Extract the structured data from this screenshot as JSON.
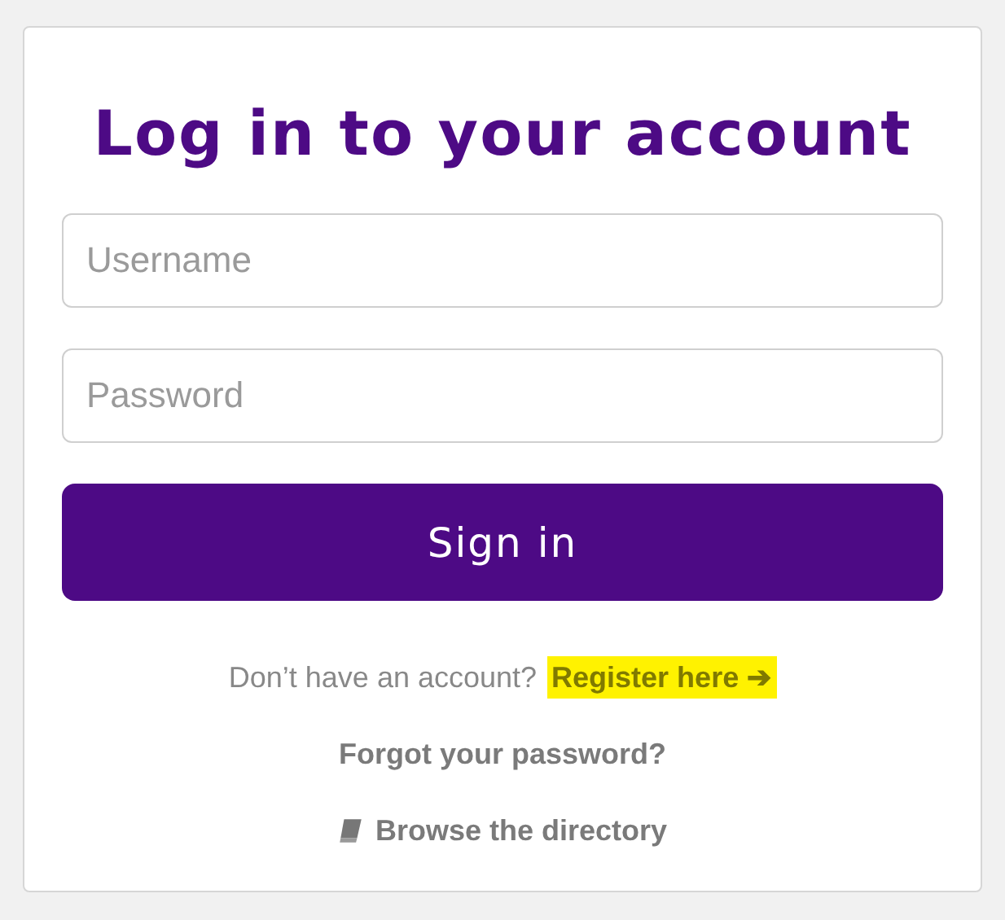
{
  "title": "Log in to your account",
  "fields": [
    {
      "placeholder": "Username"
    },
    {
      "placeholder": "Password"
    }
  ],
  "submit": "Sign in",
  "register": {
    "prompt": "Don’t have an account?",
    "link": "Register here",
    "arrow": "➔",
    "highlighted": true
  },
  "forgot": "Forgot your password?",
  "browse": "Browse the directory"
}
